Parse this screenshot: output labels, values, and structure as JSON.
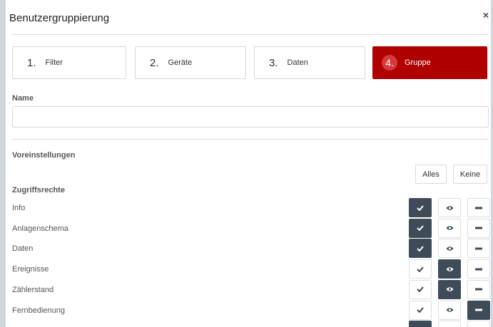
{
  "dialog": {
    "title": "Benutzergruppierung",
    "close_glyph": "×"
  },
  "steps": [
    {
      "num": "1.",
      "label": "Filter",
      "active": false
    },
    {
      "num": "2.",
      "label": "Geräte",
      "active": false
    },
    {
      "num": "3.",
      "label": "Daten",
      "active": false
    },
    {
      "num": "4.",
      "label": "Gruppe",
      "active": true
    }
  ],
  "form": {
    "name_label": "Name",
    "name_value": "",
    "presets_label": "Voreinstellungen",
    "all_button": "Alles",
    "none_button": "Keine",
    "rights_label": "Zugriffsrechte"
  },
  "permissions": [
    {
      "label": "Info",
      "selected": "write"
    },
    {
      "label": "Anlagenschema",
      "selected": "write"
    },
    {
      "label": "Daten",
      "selected": "write"
    },
    {
      "label": "Ereignisse",
      "selected": "read"
    },
    {
      "label": "Zählerstand",
      "selected": "read"
    },
    {
      "label": "Fernbedienung",
      "selected": "none"
    }
  ],
  "permission_icons": [
    "check-icon",
    "eye-icon",
    "minus-icon"
  ],
  "colors": {
    "accent": "#b00000",
    "active_step_number": "#d43a3a",
    "selected_cell": "#3f4b58",
    "icon_dark": "#3f4b58",
    "icon_light": "#ffffff"
  }
}
